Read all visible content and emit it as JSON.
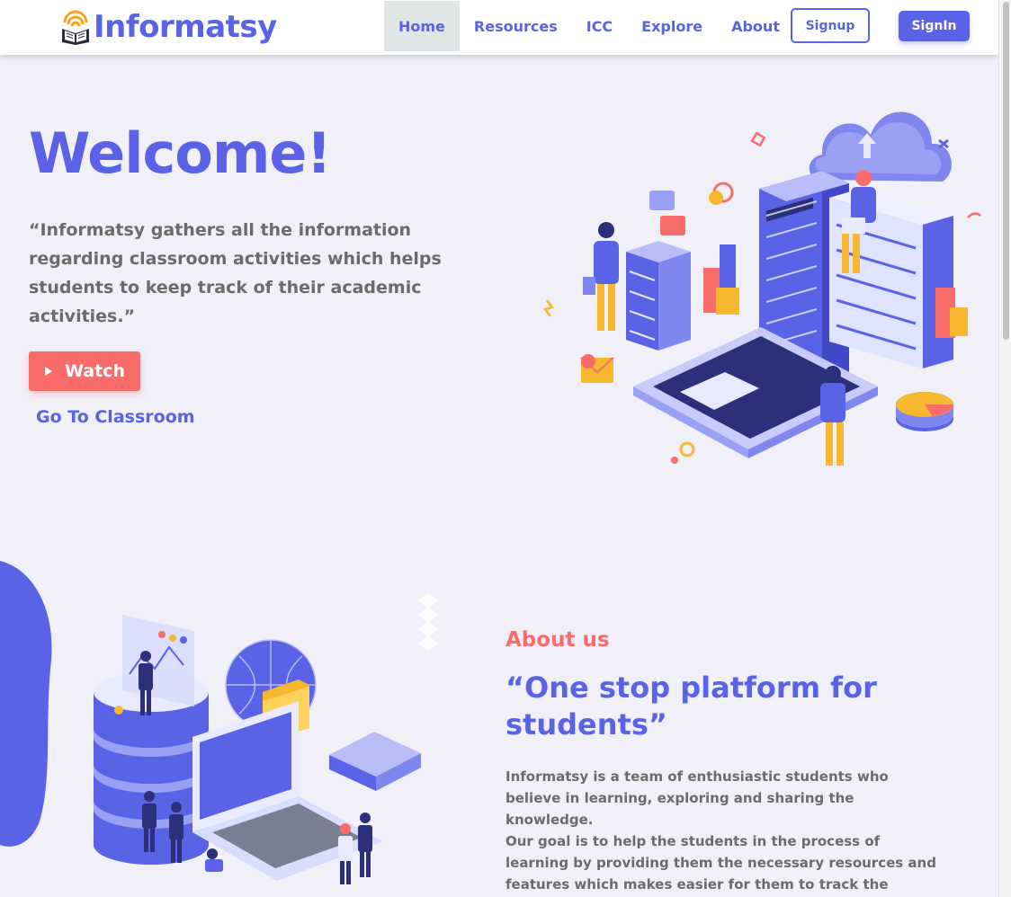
{
  "brand": {
    "name": "Informatsy",
    "color": "#5a63e6"
  },
  "nav": {
    "items": [
      {
        "label": "Home",
        "active": true
      },
      {
        "label": "Resources",
        "active": false
      },
      {
        "label": "ICC",
        "active": false
      },
      {
        "label": "Explore",
        "active": false
      },
      {
        "label": "About",
        "active": false
      }
    ],
    "signup_label": "Signup",
    "signin_label": "SignIn"
  },
  "hero": {
    "title": "Welcome!",
    "quote": "“Informatsy gathers all the information regarding classroom activities which helps students to keep track of their academic activities.”",
    "watch_label": "Watch",
    "classroom_label": "Go To Classroom"
  },
  "about": {
    "label": "About us",
    "title": "“One stop platform for students”",
    "text_1": "Informatsy is a team of enthusiastic students who believe in learning, exploring and sharing the knowledge.",
    "text_2": "Our goal is to help the students in the process of learning by providing them the necessary resources and features which makes easier for them to track the academic activities and alerts from their college."
  },
  "icons": {
    "logo": "book-wifi-icon",
    "watch": "play-icon"
  },
  "colors": {
    "accent": "#5a63e6",
    "secondary": "#fa6c6a",
    "text": "#6b6b6b",
    "background": "#f1f0f9"
  }
}
